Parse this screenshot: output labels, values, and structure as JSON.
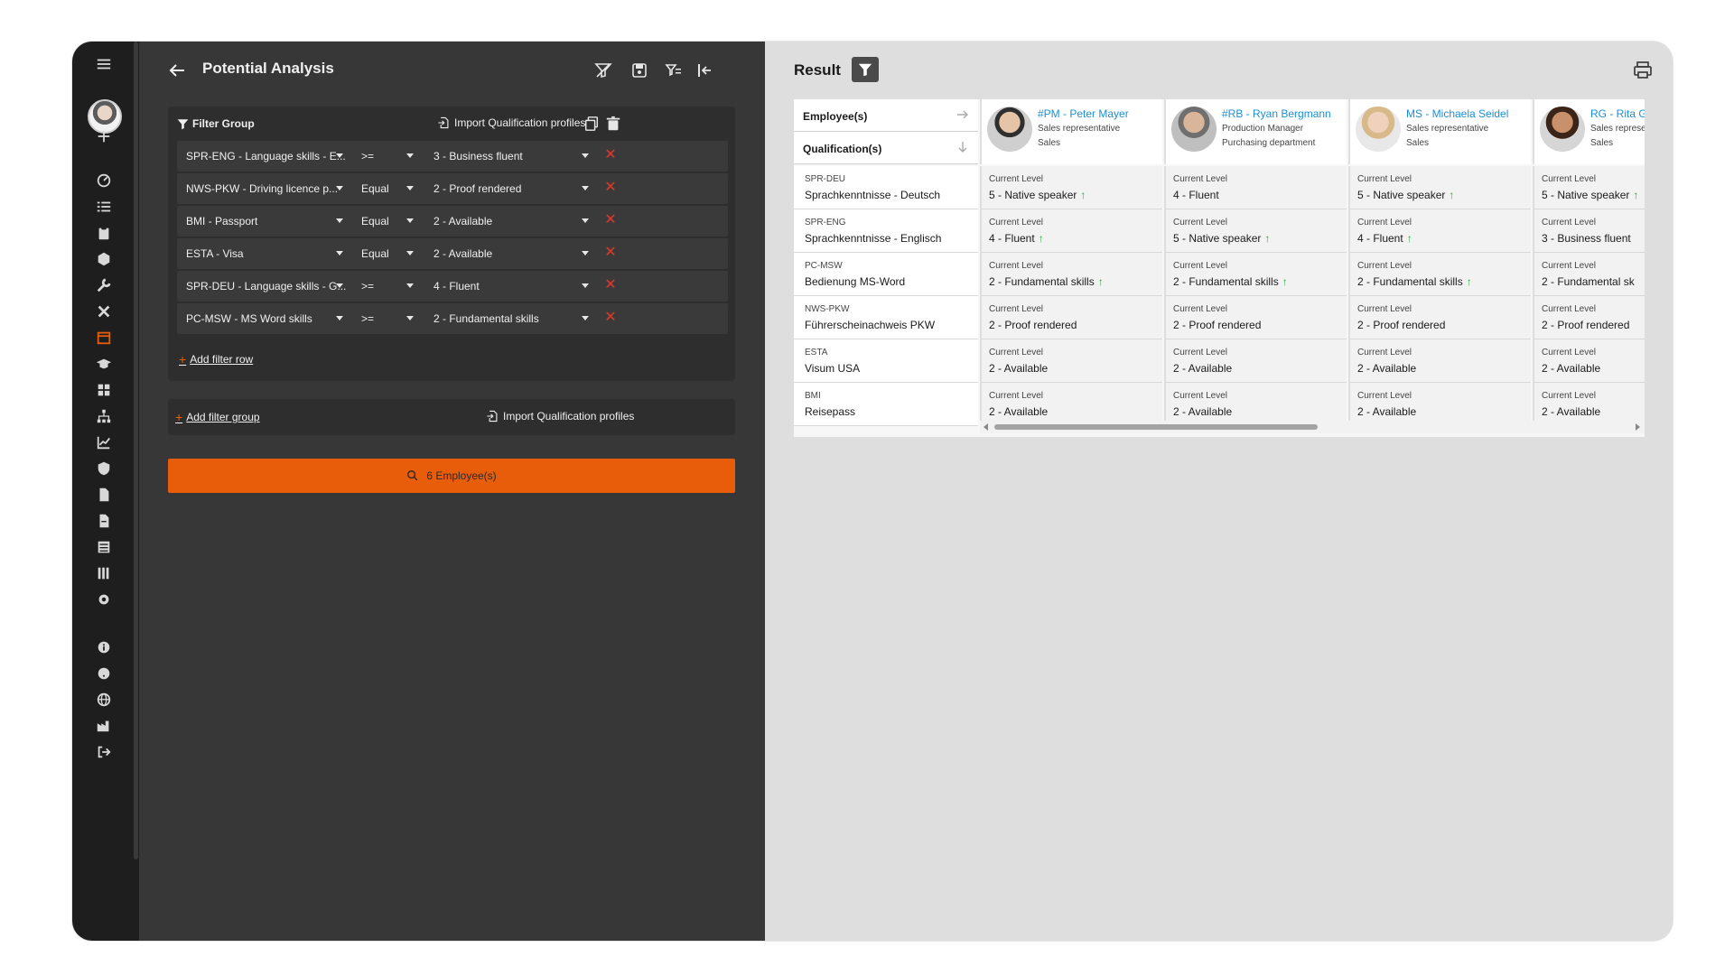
{
  "filter_panel": {
    "title": "Potential Analysis",
    "group": {
      "title": "Filter Group",
      "import_label": "Import Qualification profiles",
      "rows": [
        {
          "qualification": "SPR-ENG - Language skills - E...",
          "operator": ">=",
          "level": "3 - Business fluent"
        },
        {
          "qualification": "NWS-PKW - Driving licence p...",
          "operator": "Equal",
          "level": "2 - Proof rendered"
        },
        {
          "qualification": "BMI - Passport",
          "operator": "Equal",
          "level": "2 - Available"
        },
        {
          "qualification": "ESTA - Visa",
          "operator": "Equal",
          "level": "2 - Available"
        },
        {
          "qualification": "SPR-DEU - Language skills - G...",
          "operator": ">=",
          "level": "4 - Fluent"
        },
        {
          "qualification": "PC-MSW - MS Word skills",
          "operator": ">=",
          "level": "2 - Fundamental skills"
        }
      ],
      "add_row_label": "Add filter row"
    },
    "add_group_label": "Add filter group",
    "import_label_bottom": "Import Qualification profiles",
    "search_label": "6 Employee(s)"
  },
  "result": {
    "title": "Result",
    "row_headers": {
      "employees": "Employee(s)",
      "qualifications": "Qualification(s)"
    },
    "employees": [
      {
        "name": "#PM - Peter Mayer",
        "role": "Sales representative",
        "department": "Sales"
      },
      {
        "name": "#RB - Ryan Bergmann",
        "role": "Production Manager",
        "department": "Purchasing department"
      },
      {
        "name": "MS - Michaela Seidel",
        "role": "Sales representative",
        "department": "Sales"
      },
      {
        "name": "RG - Rita G",
        "role": "Sales represe",
        "department": "Sales"
      }
    ],
    "level_caption": "Current Level",
    "qualifications": [
      {
        "code": "SPR-DEU",
        "name": "Sprachkenntnisse - Deutsch",
        "levels": [
          {
            "value": "5 - Native speaker",
            "up": true
          },
          {
            "value": "4 - Fluent",
            "up": false
          },
          {
            "value": "5 - Native speaker",
            "up": true
          },
          {
            "value": "5 - Native speaker",
            "up": true
          }
        ]
      },
      {
        "code": "SPR-ENG",
        "name": "Sprachkenntnisse - Englisch",
        "levels": [
          {
            "value": "4 - Fluent",
            "up": true
          },
          {
            "value": "5 - Native speaker",
            "up": true
          },
          {
            "value": "4 - Fluent",
            "up": true
          },
          {
            "value": "3 - Business fluent",
            "up": false
          }
        ]
      },
      {
        "code": "PC-MSW",
        "name": "Bedienung MS-Word",
        "levels": [
          {
            "value": "2 - Fundamental skills",
            "up": true
          },
          {
            "value": "2 - Fundamental skills",
            "up": true
          },
          {
            "value": "2 - Fundamental skills",
            "up": true
          },
          {
            "value": "2 - Fundamental sk",
            "up": false
          }
        ]
      },
      {
        "code": "NWS-PKW",
        "name": "Führerscheinachweis PKW",
        "levels": [
          {
            "value": "2 - Proof rendered",
            "up": false
          },
          {
            "value": "2 - Proof rendered",
            "up": false
          },
          {
            "value": "2 - Proof rendered",
            "up": false
          },
          {
            "value": "2 - Proof rendered",
            "up": false
          }
        ]
      },
      {
        "code": "ESTA",
        "name": "Visum USA",
        "levels": [
          {
            "value": "2 - Available",
            "up": false
          },
          {
            "value": "2 - Available",
            "up": false
          },
          {
            "value": "2 - Available",
            "up": false
          },
          {
            "value": "2 - Available",
            "up": false
          }
        ]
      },
      {
        "code": "BMI",
        "name": "Reisepass",
        "levels": [
          {
            "value": "2 - Available",
            "up": false
          },
          {
            "value": "2 - Available",
            "up": false
          },
          {
            "value": "2 - Available",
            "up": false
          },
          {
            "value": "2 - Available",
            "up": false
          }
        ]
      }
    ]
  },
  "icons": {
    "rail": [
      "hamburger-menu-icon",
      "plus-icon",
      "dashboard-icon",
      "checklist-icon",
      "clipboard-icon",
      "box-icon",
      "wrench-icon",
      "tools-icon",
      "calendar-icon",
      "graduation-cap-icon",
      "share-icon",
      "org-chart-icon",
      "chart-icon",
      "shield-icon",
      "document-check-icon",
      "document-icon",
      "list-icon",
      "library-icon",
      "gear-icon",
      "info-icon",
      "help-icon",
      "globe-icon",
      "factory-icon",
      "logout-icon"
    ],
    "header": [
      "clear-filter-icon",
      "save-icon",
      "filter-list-icon",
      "collapse-panel-icon"
    ]
  },
  "colors": {
    "accent": "#e85d0a",
    "link": "#1a8fd8",
    "danger": "#e0392b",
    "positive": "#2aa84a",
    "dark_panel": "#373737",
    "rail": "#1e1e1e"
  }
}
